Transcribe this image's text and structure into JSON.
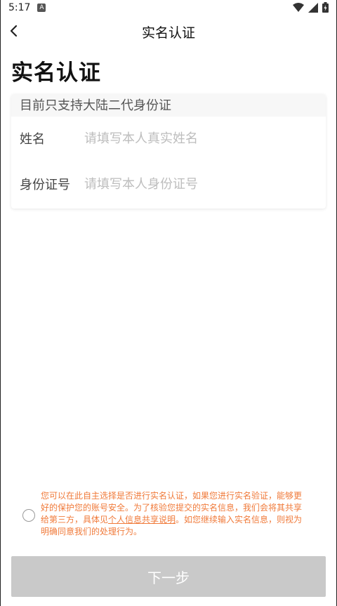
{
  "status_bar": {
    "time": "5:17",
    "notification_icon": "a-icon",
    "icons": [
      "wifi-icon",
      "signal-icon",
      "battery-icon"
    ]
  },
  "nav": {
    "back_icon": "back-arrow-icon",
    "title": "实名认证"
  },
  "page": {
    "heading": "实名认证"
  },
  "form": {
    "notice": "目前只支持大陆二代身份证",
    "name_label": "姓名",
    "name_placeholder": "请填写本人真实姓名",
    "name_value": "",
    "id_label": "身份证号",
    "id_placeholder": "请填写本人身份证号",
    "id_value": ""
  },
  "consent": {
    "checked": false,
    "text_before": "您可以在此自主选择是否进行实名认证，如果您进行实名验证，能够更好的保护您的账号安全。为了核验您提交的实名信息，我们会将其共享给第三方，具体见",
    "link": "个人信息共享说明",
    "text_after": "。如您继续输入实名信息，则视为明确同意我们的处理行为。"
  },
  "next_button": {
    "label": "下一步"
  },
  "colors": {
    "accent_text": "#f07a3a",
    "disabled_button": "#c9c9c9"
  }
}
